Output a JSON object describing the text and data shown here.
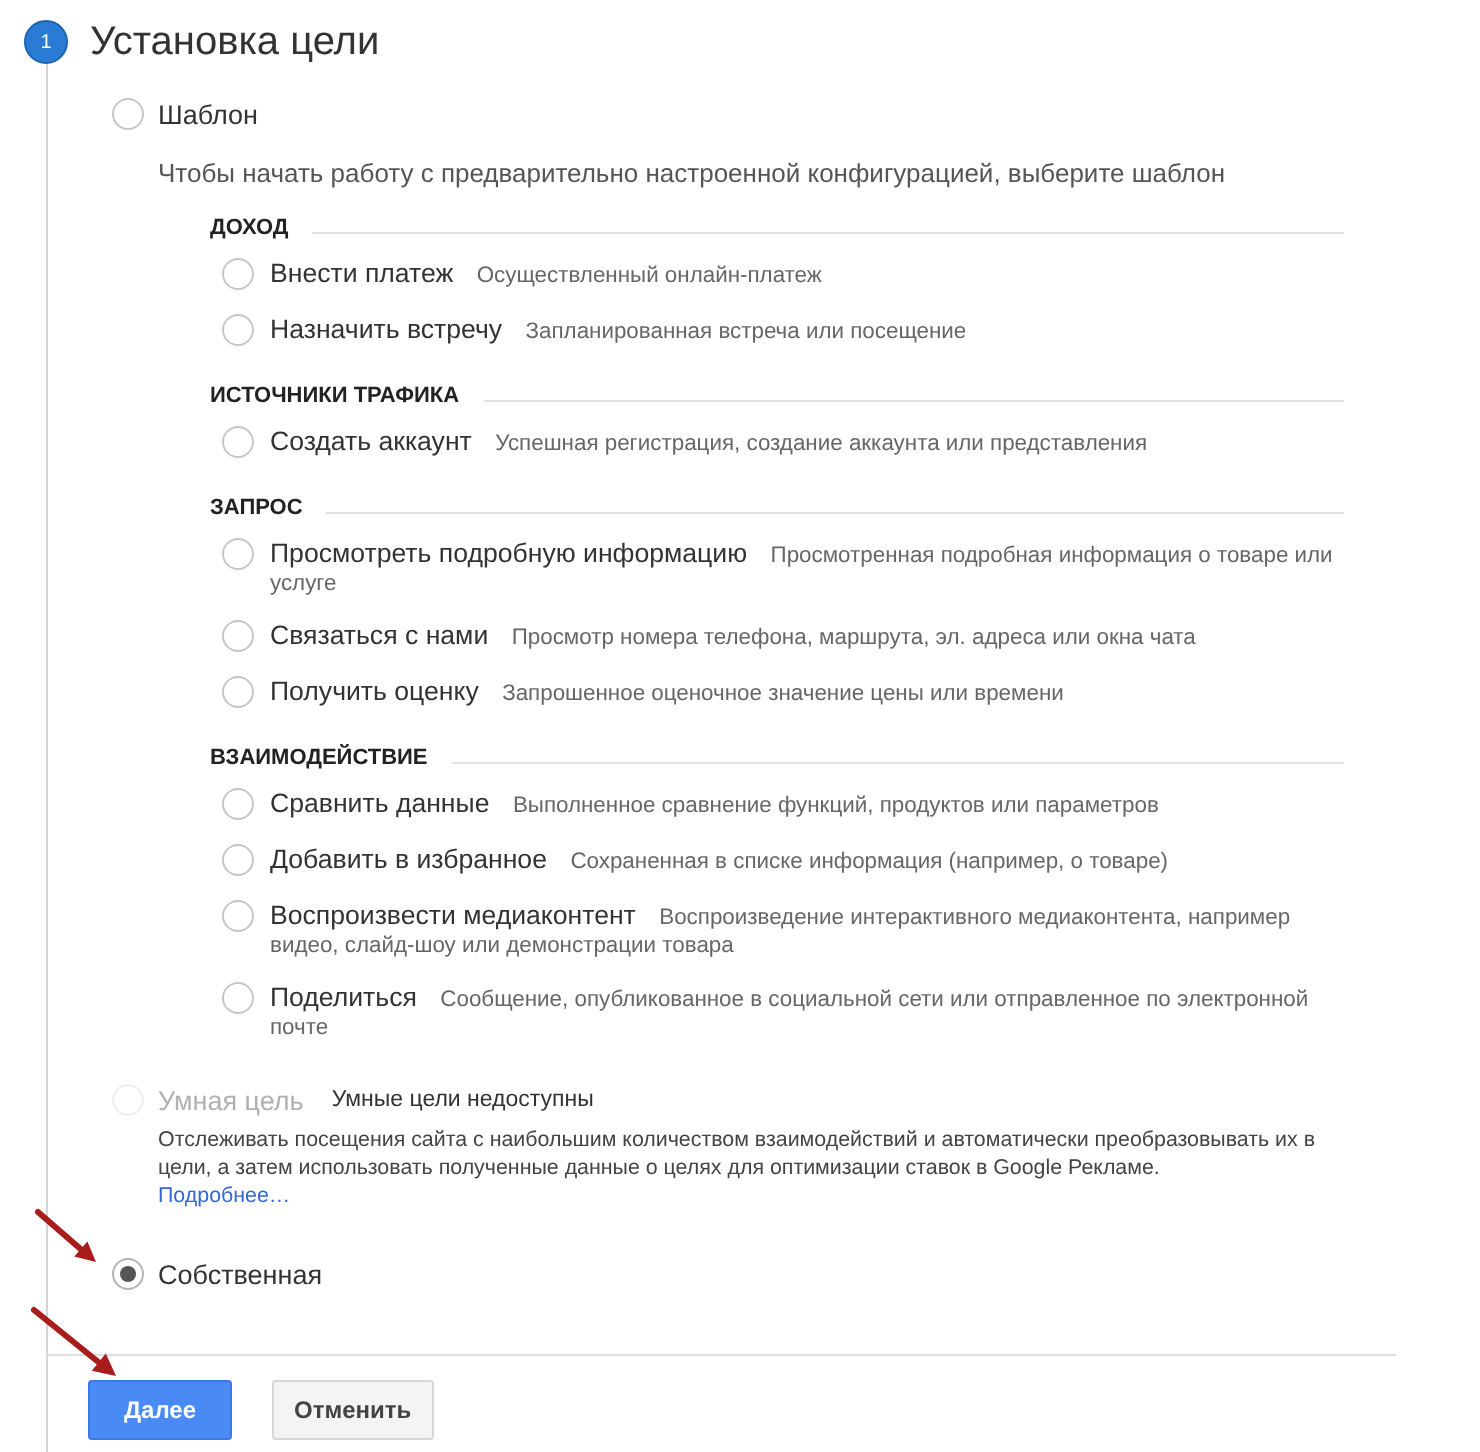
{
  "step": {
    "number": "1",
    "title": "Установка цели"
  },
  "goal_types": [
    {
      "kind": "template",
      "label": "Шаблон",
      "selected": false,
      "disabled": false,
      "description": "Чтобы начать работу с предварительно настроенной конфигурацией, выберите шаблон",
      "groups": [
        {
          "heading": "ДОХОД",
          "options": [
            {
              "label": "Внести платеж",
              "description": "Осуществленный онлайн-платеж",
              "selected": false
            },
            {
              "label": "Назначить встречу",
              "description": "Запланированная встреча или посещение",
              "selected": false
            }
          ]
        },
        {
          "heading": "ИСТОЧНИКИ ТРАФИКА",
          "options": [
            {
              "label": "Создать аккаунт",
              "description": "Успешная регистрация, создание аккаунта или представления",
              "selected": false
            }
          ]
        },
        {
          "heading": "ЗАПРОС",
          "options": [
            {
              "label": "Просмотреть подробную информацию",
              "description": "Просмотренная подробная информация о товаре или услуге",
              "selected": false
            },
            {
              "label": "Связаться с нами",
              "description": "Просмотр номера телефона, маршрута, эл. адреса или окна чата",
              "selected": false
            },
            {
              "label": "Получить оценку",
              "description": "Запрошенное оценочное значение цены или времени",
              "selected": false
            }
          ]
        },
        {
          "heading": "ВЗАИМОДЕЙСТВИЕ",
          "options": [
            {
              "label": "Сравнить данные",
              "description": "Выполненное сравнение функций, продуктов или параметров",
              "selected": false
            },
            {
              "label": "Добавить в избранное",
              "description": "Сохраненная в списке информация (например, о товаре)",
              "selected": false
            },
            {
              "label": "Воспроизвести медиаконтент",
              "description": "Воспроизведение интерактивного медиаконтента, например видео, слайд-шоу или демонстрации товара",
              "selected": false
            },
            {
              "label": "Поделиться",
              "description": "Сообщение, опубликованное в социальной сети или отправленное по электронной почте",
              "selected": false
            }
          ]
        }
      ]
    },
    {
      "kind": "smart",
      "label": "Умная цель",
      "selected": false,
      "disabled": true,
      "note": "Умные цели недоступны",
      "description": "Отслеживать посещения сайта с наибольшим количеством взаимодействий и автоматически преобразовывать их в цели, а затем использовать полученные данные о целях для оптимизации ставок в Google Рекламе.",
      "link": "Подробнее…"
    },
    {
      "kind": "custom",
      "label": "Собственная",
      "selected": true,
      "disabled": false
    }
  ],
  "buttons": [
    {
      "kind": "primary",
      "label": "Далее"
    },
    {
      "kind": "secondary",
      "label": "Отменить"
    }
  ]
}
